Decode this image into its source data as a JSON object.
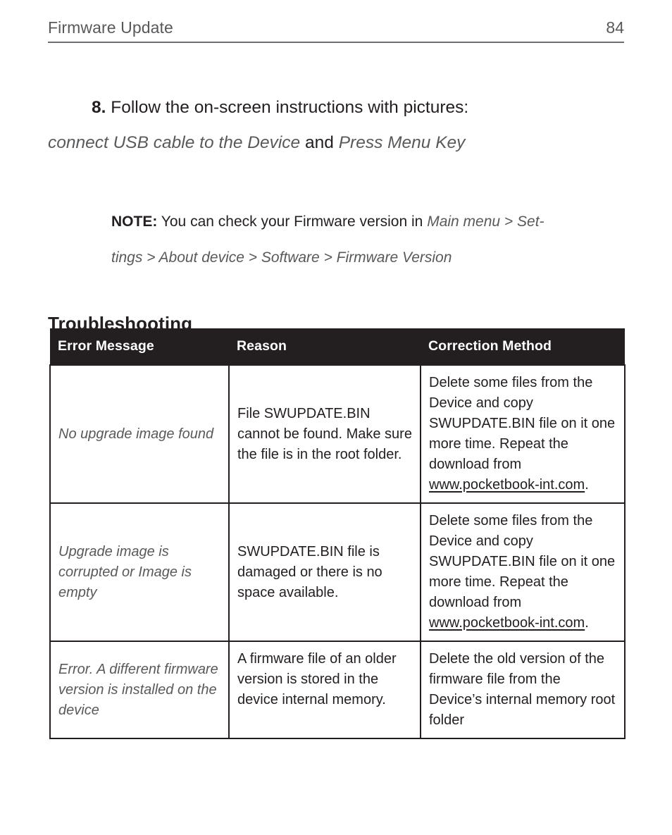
{
  "header": {
    "title": "Firmware Update",
    "page_number": "84"
  },
  "step": {
    "number": "8.",
    "text_before": "Follow the on-screen instructions with pictures:",
    "italic_1": "connect USB cable to the Device",
    "conjunction": "and",
    "italic_2": "Press Menu Key"
  },
  "note": {
    "label": "NOTE:",
    "text": "You can check your Firmware version in",
    "path_line1": "Main menu > Set-",
    "path_line2": "tings > About device > Software > Firmware Version"
  },
  "troubleshooting": {
    "heading": "Troubleshooting",
    "columns": [
      "Error Message",
      "Reason",
      "Correction Method"
    ],
    "rows": [
      {
        "error": "No upgrade image found",
        "reason": "File SWUPDATE.BIN cannot be found. Make sure the file is in the root folder.",
        "fix_before": "Delete some files from the Device and copy SWUPDATE.BIN file on it one more time. Repeat the download from ",
        "fix_link": "www.pocketbook-int.com",
        "fix_after": "."
      },
      {
        "error": "Upgrade image is corrupted or Image is empty",
        "reason": "SWUPDATE.BIN file is damaged or there is no space available.",
        "fix_before": "Delete some files from the Device and copy SWUPDATE.BIN file on it one more time. Repeat the download from ",
        "fix_link": "www.pocketbook-int.com",
        "fix_after": "."
      },
      {
        "error": "Error. A different firmware version is installed on the device",
        "reason": "A firmware file of an older version is stored in the device internal memory.",
        "fix_before": "Delete the old version of the firmware file from the Device’s internal memory root folder",
        "fix_link": "",
        "fix_after": ""
      }
    ]
  },
  "colors": {
    "ink": "#231f20",
    "gray_text": "#58595b",
    "rule": "#6d6e71",
    "header_fill": "#231f20"
  }
}
